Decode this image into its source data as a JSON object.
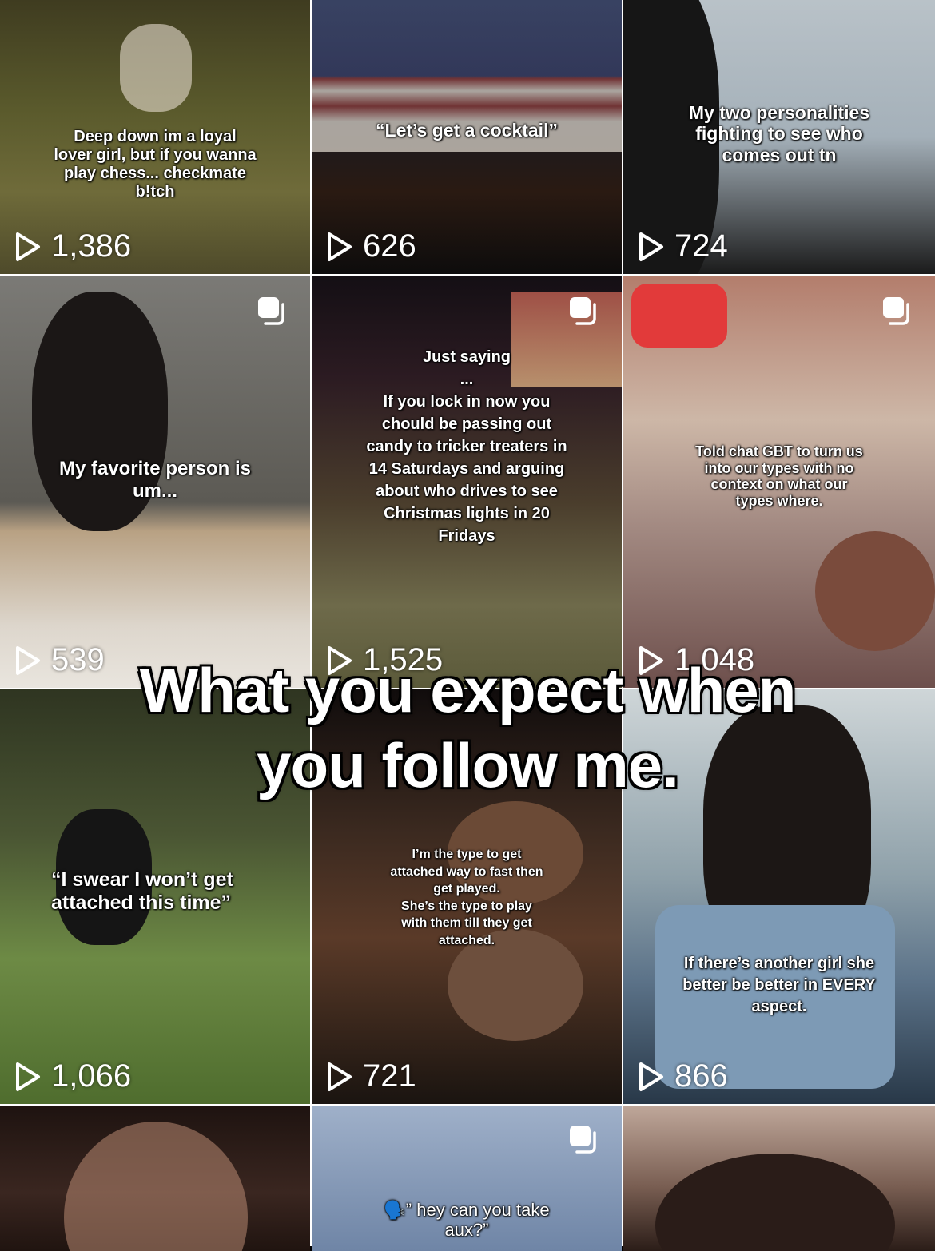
{
  "tiles": [
    {
      "caption": "Deep down im a loyal\nlover girl, but if you wanna\nplay chess... checkmate\nb!tch",
      "views": "1,386",
      "multi": false
    },
    {
      "caption": "“Let’s get a cocktail”",
      "views": "626",
      "multi": false
    },
    {
      "caption": "My two personalities\nfighting to see who\ncomes out tn",
      "views": "724",
      "multi": false
    },
    {
      "caption": "My favorite person is\num...",
      "views": "539",
      "multi": true
    },
    {
      "caption": "Just saying\n...\nIf you lock in now you\nchould be passing out\ncandy to tricker treaters in\n14 Saturdays and arguing\nabout who drives to see\nChristmas lights in 20\nFridays",
      "views": "1,525",
      "multi": true
    },
    {
      "caption": "Told chat GBT to turn us\ninto our types with no\ncontext on what our\ntypes where.",
      "views": "1,048",
      "multi": true
    },
    {
      "caption": "“I swear I won’t get\nattached this time”",
      "views": "1,066",
      "multi": false
    },
    {
      "caption": "I’m the type to get\nattached way to fast then\nget played.\nShe’s the type to play\nwith them till they get\nattached.",
      "views": "721",
      "multi": false
    },
    {
      "caption": "If there’s another girl she\nbetter be better in EVERY\naspect.",
      "views": "866",
      "multi": false
    },
    {
      "caption": "",
      "views": "",
      "multi": false
    },
    {
      "caption": "🗣️” hey can you take\naux?”",
      "views": "",
      "multi": true
    },
    {
      "caption": "",
      "views": "",
      "multi": false
    }
  ],
  "overlay_text": "What you expect when\nyou follow me."
}
